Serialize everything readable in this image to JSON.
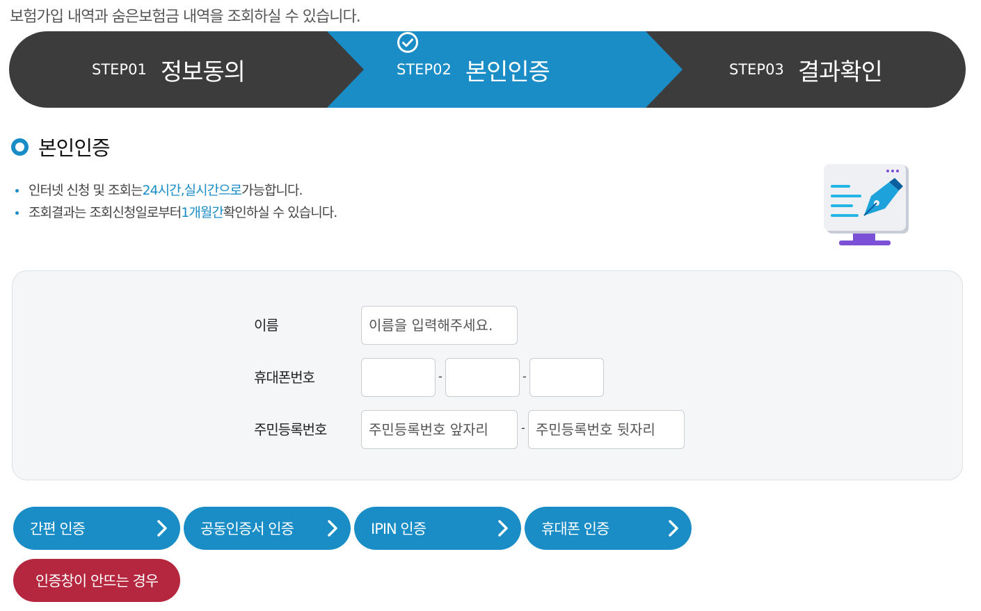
{
  "intro": "보험가입 내역과 숨은보험금 내역을 조회하실 수 있습니다.",
  "steps": [
    {
      "num": "STEP01",
      "name": "정보동의"
    },
    {
      "num": "STEP02",
      "name": "본인인증"
    },
    {
      "num": "STEP03",
      "name": "결과확인"
    }
  ],
  "section_title": "본인인증",
  "bullets": [
    {
      "pre": "인터넷 신청 및 조회는 ",
      "hl1": "24시간",
      "mid": ", ",
      "hl2": "실시간으로",
      "post": " 가능합니다."
    },
    {
      "pre": "조회결과는 조회신청일로부터 ",
      "hl1": "1개월간",
      "post": " 확인하실 수 있습니다."
    }
  ],
  "form": {
    "name_label": "이름",
    "name_placeholder": "이름을 입력해주세요.",
    "phone_label": "휴대폰번호",
    "dash": "-",
    "rrn_label": "주민등록번호",
    "rrn_front_placeholder": "주민등록번호 앞자리",
    "rrn_back_placeholder": "주민등록번호 뒷자리"
  },
  "auth_buttons": [
    {
      "label": "간편 인증"
    },
    {
      "label": "공동인증서 인증"
    },
    {
      "label": "IPIN 인증"
    },
    {
      "label": "휴대폰 인증"
    }
  ],
  "help_button": "인증창이 안뜨는 경우",
  "colors": {
    "accent": "#1a8dc6",
    "dark": "#3c3c3c",
    "danger": "#b5263f"
  },
  "icons": {
    "step_current": "check-circle-icon",
    "button_arrow": "chevron-right-icon",
    "illustration": "monitor-pen-icon"
  }
}
